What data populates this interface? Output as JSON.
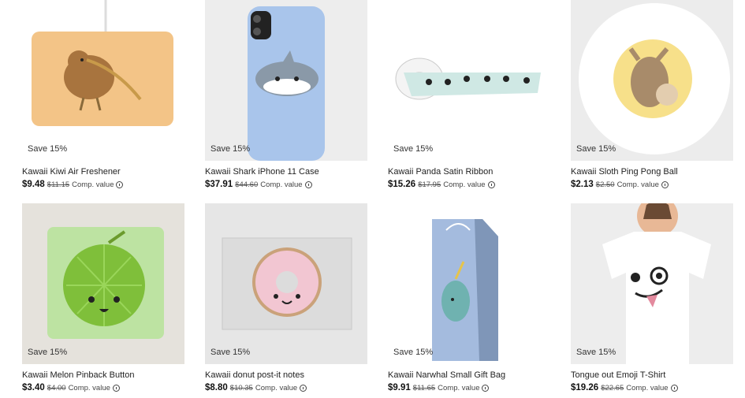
{
  "products": [
    {
      "title": "Kawaii Kiwi Air Freshener",
      "price": "$9.48",
      "original_price": "$11.15",
      "comp_label": "Comp. value",
      "badge": "Save 15%"
    },
    {
      "title": "Kawaii Shark iPhone 11 Case",
      "price": "$37.91",
      "original_price": "$44.60",
      "comp_label": "Comp. value",
      "badge": "Save 15%"
    },
    {
      "title": "Kawaii Panda Satin Ribbon",
      "price": "$15.26",
      "original_price": "$17.95",
      "comp_label": "Comp. value",
      "badge": "Save 15%"
    },
    {
      "title": "Kawaii Sloth Ping Pong Ball",
      "price": "$2.13",
      "original_price": "$2.50",
      "comp_label": "Comp. value",
      "badge": "Save 15%"
    },
    {
      "title": "Kawaii Melon Pinback Button",
      "price": "$3.40",
      "original_price": "$4.00",
      "comp_label": "Comp. value",
      "badge": "Save 15%"
    },
    {
      "title": "Kawaii donut post-it notes",
      "price": "$8.80",
      "original_price": "$10.35",
      "comp_label": "Comp. value",
      "badge": "Save 15%"
    },
    {
      "title": "Kawaii Narwhal Small Gift Bag",
      "price": "$9.91",
      "original_price": "$11.65",
      "comp_label": "Comp. value",
      "badge": "Save 15%"
    },
    {
      "title": "Tongue out Emoji T-Shirt",
      "price": "$19.26",
      "original_price": "$22.65",
      "comp_label": "Comp. value",
      "badge": "Save 15%"
    }
  ]
}
